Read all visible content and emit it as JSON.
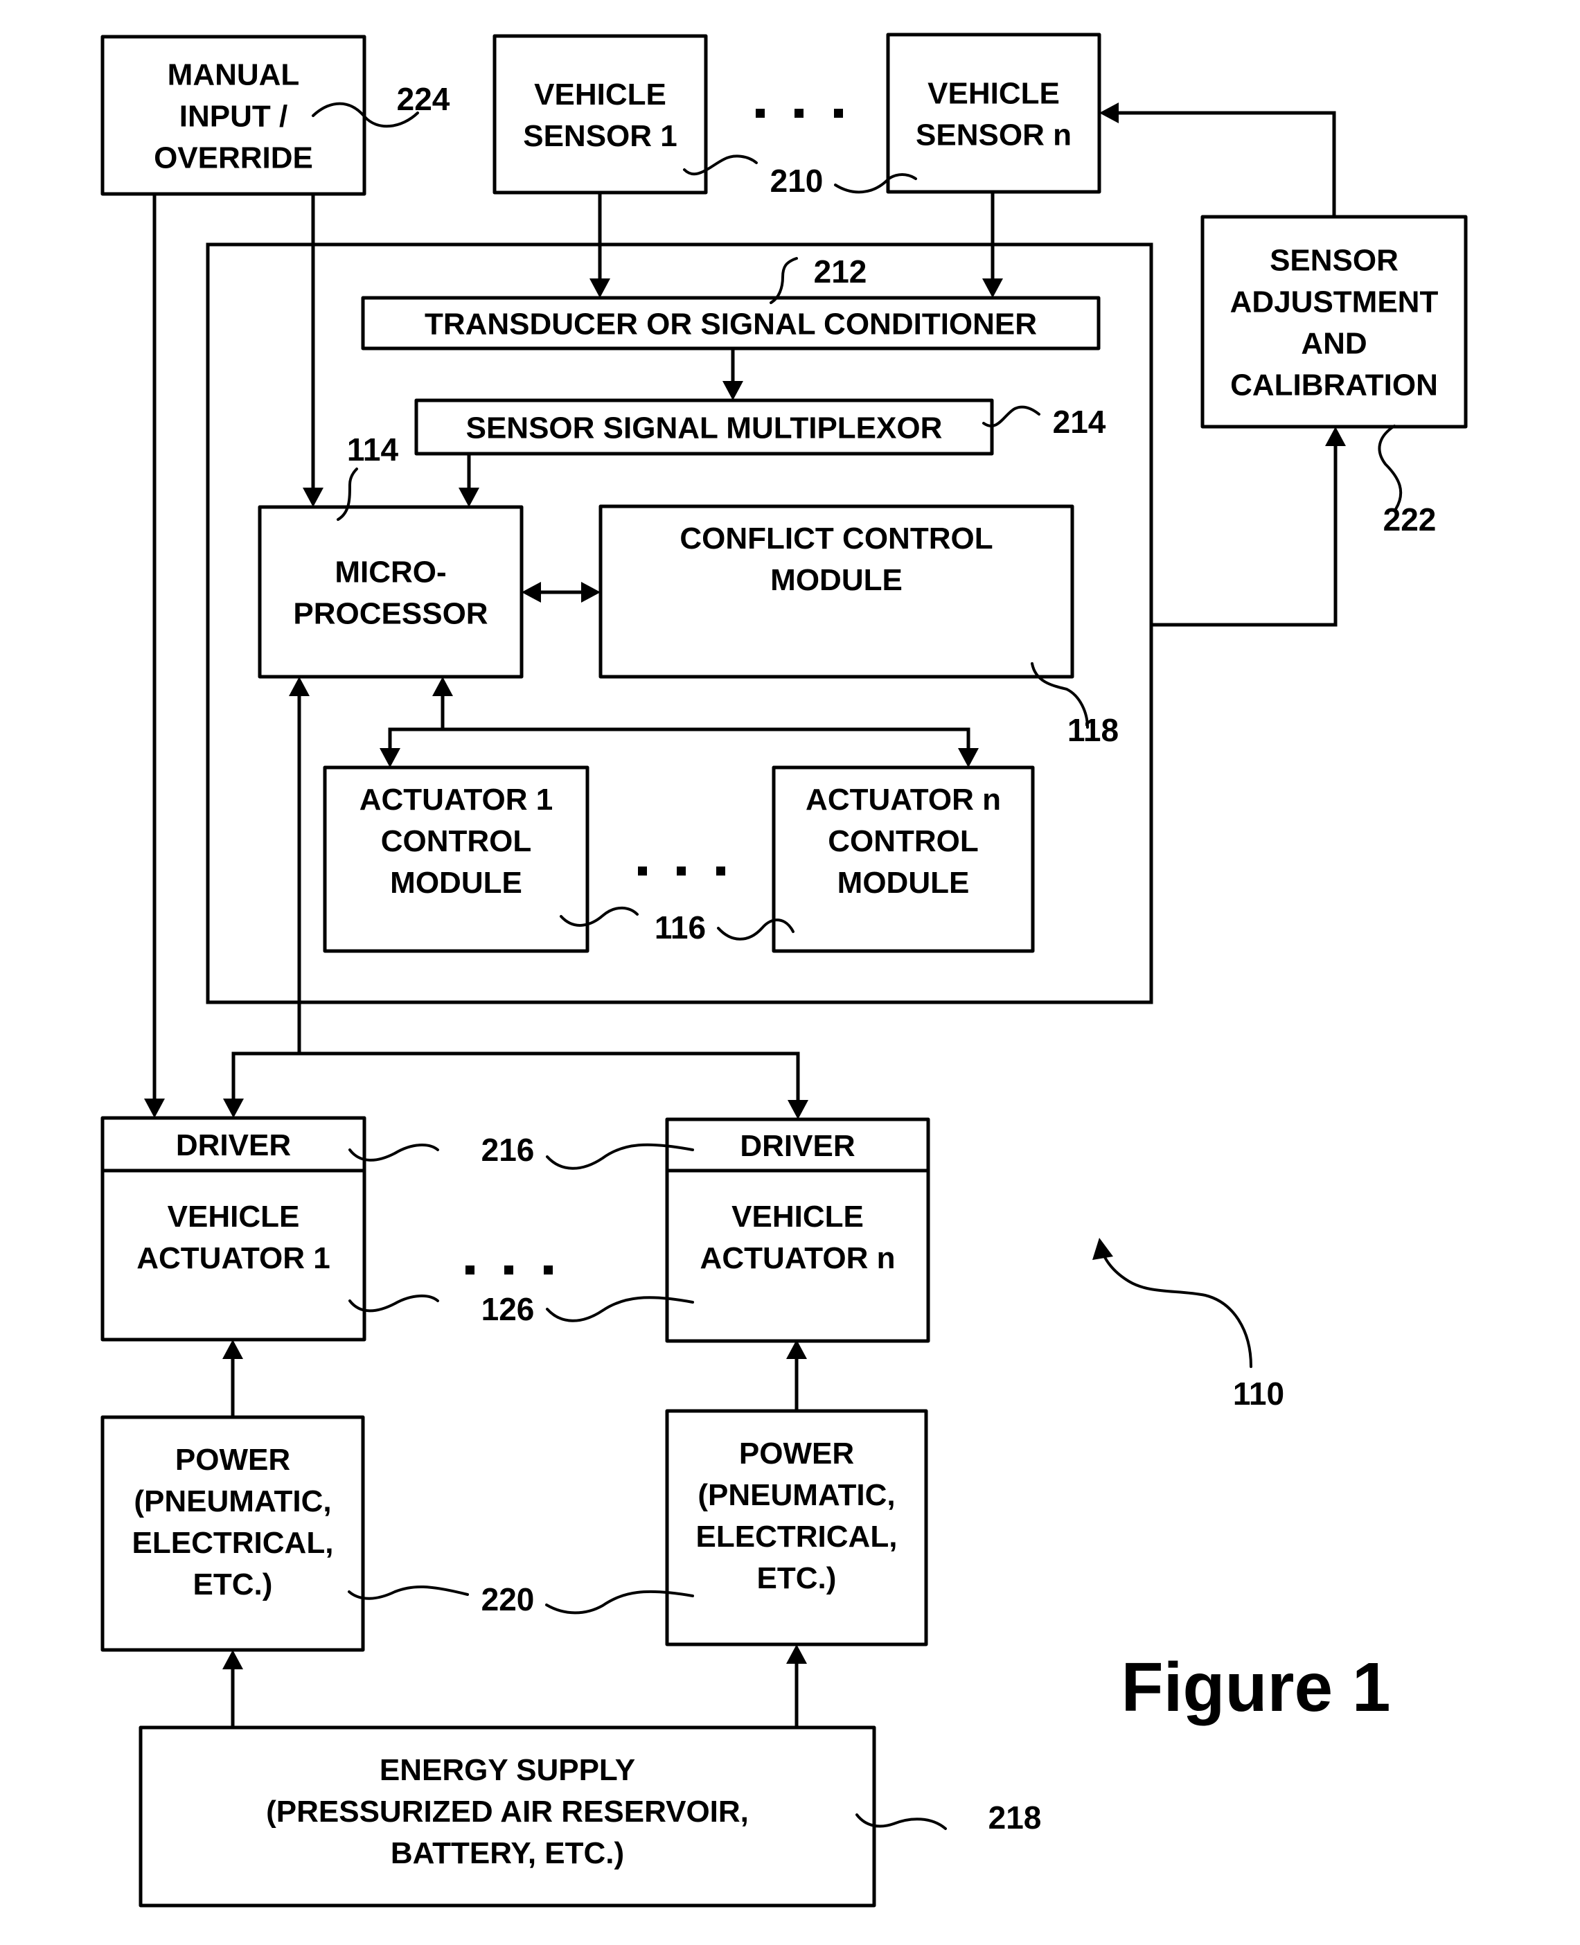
{
  "figure": {
    "title": "Figure 1",
    "system_reference": "110"
  },
  "blocks": {
    "manual_input": {
      "lines": [
        "MANUAL",
        "INPUT /",
        "OVERRIDE"
      ],
      "ref": "224"
    },
    "vehicle_sensor_1": {
      "lines": [
        "VEHICLE",
        "SENSOR 1"
      ]
    },
    "vehicle_sensor_n": {
      "lines": [
        "VEHICLE",
        "SENSOR n"
      ]
    },
    "vehicle_sensors_ref": "210",
    "sensor_adjustment": {
      "lines": [
        "SENSOR",
        "ADJUSTMENT",
        "AND",
        "CALIBRATION"
      ],
      "ref": "222"
    },
    "transducer": {
      "lines": [
        "TRANSDUCER OR SIGNAL CONDITIONER"
      ],
      "ref": "212"
    },
    "multiplexor": {
      "lines": [
        "SENSOR SIGNAL MULTIPLEXOR"
      ],
      "ref": "214"
    },
    "microprocessor": {
      "lines": [
        "MICRO-",
        "PROCESSOR"
      ],
      "ref": "114"
    },
    "conflict_control": {
      "lines": [
        "CONFLICT CONTROL",
        "MODULE"
      ],
      "ref": "118"
    },
    "actuator_1_control": {
      "lines": [
        "ACTUATOR 1",
        "CONTROL",
        "MODULE"
      ]
    },
    "actuator_n_control": {
      "lines": [
        "ACTUATOR n",
        "CONTROL",
        "MODULE"
      ]
    },
    "actuator_control_ref": "116",
    "driver_1": {
      "lines": [
        "DRIVER"
      ]
    },
    "driver_n": {
      "lines": [
        "DRIVER"
      ]
    },
    "driver_ref": "216",
    "vehicle_actuator_1": {
      "lines": [
        "VEHICLE",
        "ACTUATOR 1"
      ]
    },
    "vehicle_actuator_n": {
      "lines": [
        "VEHICLE",
        "ACTUATOR n"
      ]
    },
    "vehicle_actuator_ref": "126",
    "power_1": {
      "lines": [
        "POWER",
        "(PNEUMATIC,",
        "ELECTRICAL,",
        "ETC.)"
      ]
    },
    "power_n": {
      "lines": [
        "POWER",
        "(PNEUMATIC,",
        "ELECTRICAL,",
        "ETC.)"
      ]
    },
    "power_ref": "220",
    "energy_supply": {
      "lines": [
        "ENERGY SUPPLY",
        "(PRESSURIZED AIR RESERVOIR,",
        "BATTERY, ETC.)"
      ],
      "ref": "218"
    }
  },
  "ellipsis": "..."
}
